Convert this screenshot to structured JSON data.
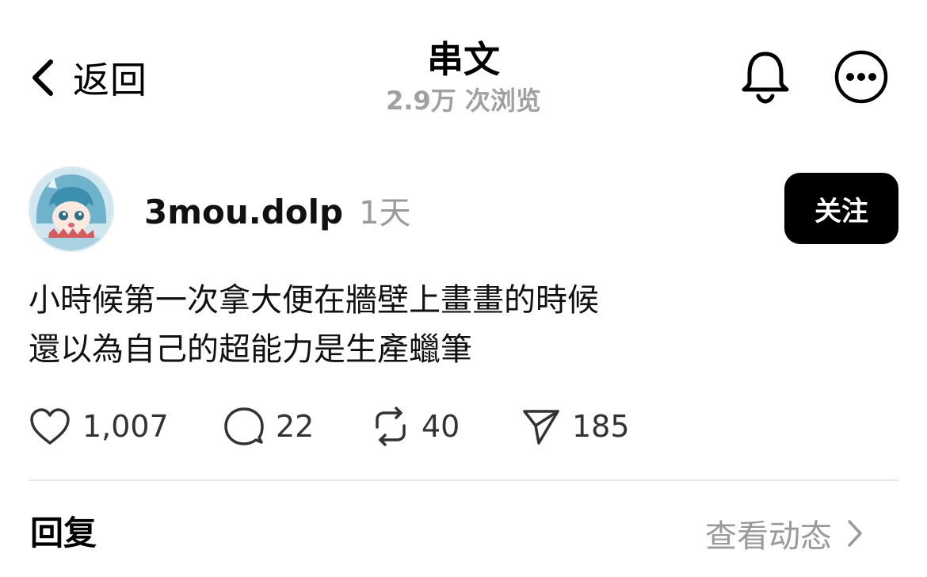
{
  "header": {
    "back_label": "返回",
    "title": "串文",
    "views": "2.9万 次浏览"
  },
  "post": {
    "author": "3mou.dolp",
    "time": "1天",
    "follow_label": "关注",
    "text_lines": [
      "小時候第一次拿大便在牆壁上畫畫的時候",
      "還以為自己的超能力是生產蠟筆"
    ],
    "stats": {
      "likes": "1,007",
      "comments": "22",
      "reposts": "40",
      "shares": "185"
    }
  },
  "replies": {
    "title": "回复",
    "view_activity": "查看动态"
  },
  "icons": {
    "back": "chevron-left-icon",
    "bell": "bell-icon",
    "more": "more-icon",
    "like": "heart-icon",
    "comment": "comment-icon",
    "repost": "repost-icon",
    "share": "send-icon",
    "chevron": "chevron-right-icon"
  },
  "colors": {
    "follow_bg": "#000000",
    "muted_text": "#9a9a9a"
  }
}
